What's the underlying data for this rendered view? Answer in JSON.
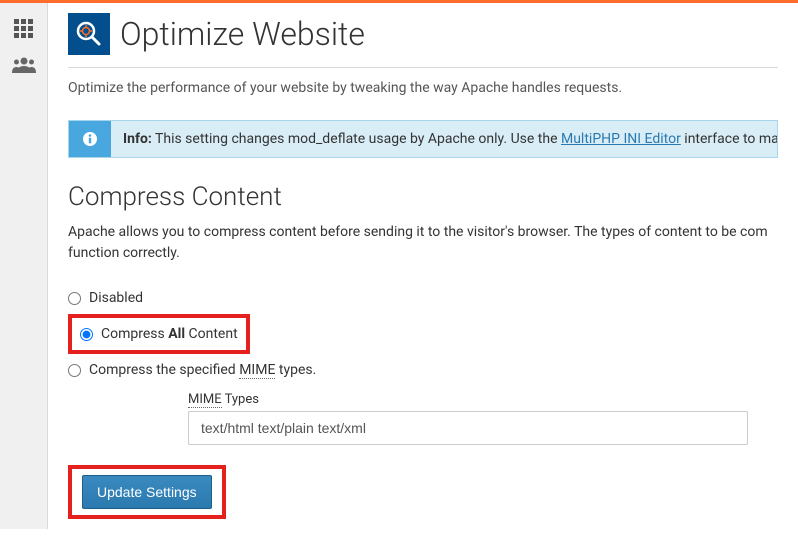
{
  "page": {
    "title": "Optimize Website",
    "intro": "Optimize the performance of your website by tweaking the way Apache handles requests."
  },
  "alert": {
    "label": "Info:",
    "text1": " This setting changes mod_deflate usage by Apache only. Use the ",
    "link": "MultiPHP INI Editor",
    "text2": " interface to ma"
  },
  "compress": {
    "title": "Compress Content",
    "desc": "Apache allows you to compress content before sending it to the visitor's browser. The types of content to be com function correctly.",
    "options": {
      "disabled": "Disabled",
      "all_pre": "Compress ",
      "all_bold": "All",
      "all_post": " Content",
      "specified_pre": "Compress the specified ",
      "specified_mime": "MIME",
      "specified_post": " types."
    },
    "mime_label_pre": "MIME",
    "mime_label_post": " Types",
    "mime_value": "text/html text/plain text/xml"
  },
  "buttons": {
    "update": "Update Settings"
  }
}
